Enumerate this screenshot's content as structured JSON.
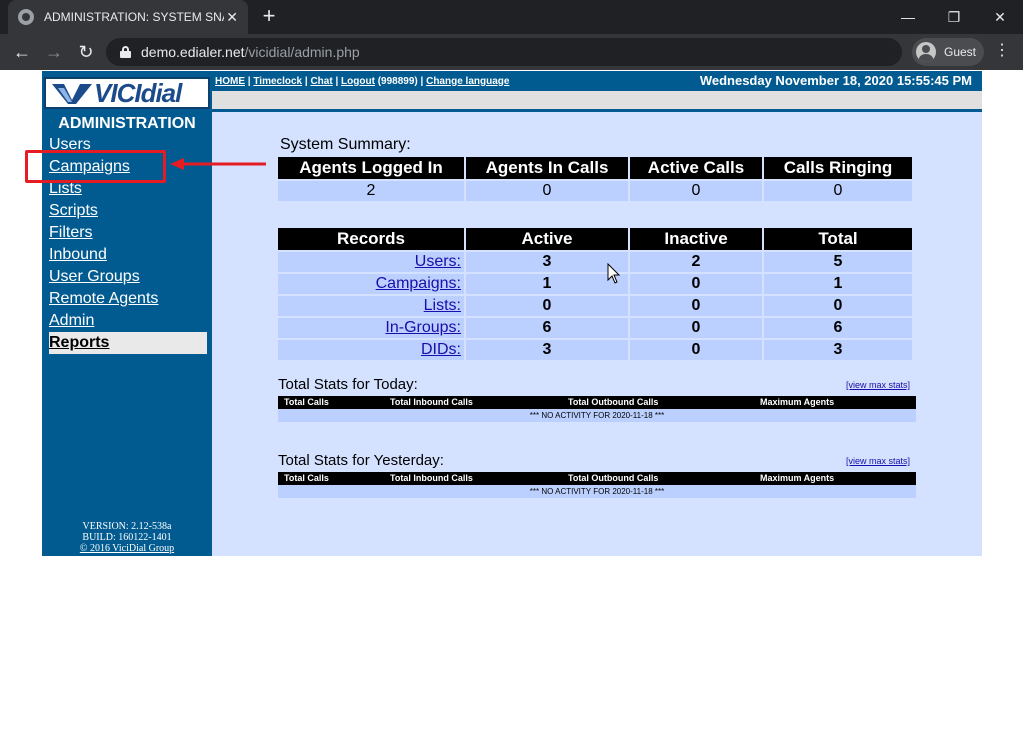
{
  "browser": {
    "tab_title": "ADMINISTRATION: SYSTEM SNAP",
    "url_host": "demo.edialer.net",
    "url_path": "/vicidial/admin.php",
    "profile_label": "Guest"
  },
  "sidebar": {
    "logo_text": "VICIdial",
    "heading": "ADMINISTRATION",
    "items": [
      {
        "label": "Users"
      },
      {
        "label": "Campaigns"
      },
      {
        "label": "Lists"
      },
      {
        "label": "Scripts"
      },
      {
        "label": "Filters"
      },
      {
        "label": "Inbound"
      },
      {
        "label": "User Groups"
      },
      {
        "label": "Remote Agents"
      },
      {
        "label": "Admin"
      },
      {
        "label": "Reports"
      }
    ],
    "version": "VERSION: 2.12-538a",
    "build": "BUILD: 160122-1401",
    "copyright": "© 2016 ViciDial Group"
  },
  "topbar": {
    "home": "HOME",
    "timeclock": "Timeclock",
    "chat": "Chat",
    "logout": "Logout",
    "user_id": "(998899)",
    "change_language": "Change language",
    "datetime": "Wednesday November 18, 2020 15:55:45 PM"
  },
  "summary": {
    "title": "System Summary:",
    "headers": [
      "Agents Logged In",
      "Agents In Calls",
      "Active Calls",
      "Calls Ringing"
    ],
    "values": [
      "2",
      "0",
      "0",
      "0"
    ]
  },
  "records": {
    "headers": [
      "Records",
      "Active",
      "Inactive",
      "Total"
    ],
    "rows": [
      {
        "label": "Users:",
        "active": "3",
        "inactive": "2",
        "total": "5"
      },
      {
        "label": "Campaigns:",
        "active": "1",
        "inactive": "0",
        "total": "1"
      },
      {
        "label": "Lists:",
        "active": "0",
        "inactive": "0",
        "total": "0"
      },
      {
        "label": "In-Groups:",
        "active": "6",
        "inactive": "0",
        "total": "6"
      },
      {
        "label": "DIDs:",
        "active": "3",
        "inactive": "0",
        "total": "3"
      }
    ]
  },
  "stats_today": {
    "title": "Total Stats for Today:",
    "link": "[view max stats]",
    "headers": [
      "Total Calls",
      "Total Inbound Calls",
      "Total Outbound Calls",
      "Maximum Agents"
    ],
    "message": "*** NO ACTIVITY FOR 2020-11-18 ***"
  },
  "stats_yesterday": {
    "title": "Total Stats for Yesterday:",
    "link": "[view max stats]",
    "headers": [
      "Total Calls",
      "Total Inbound Calls",
      "Total Outbound Calls",
      "Maximum Agents"
    ],
    "message": "*** NO ACTIVITY FOR 2020-11-18 ***"
  },
  "colors": {
    "sidebar": "#015b91",
    "content": "#d4e2ff",
    "annotation": "#e51c23"
  }
}
